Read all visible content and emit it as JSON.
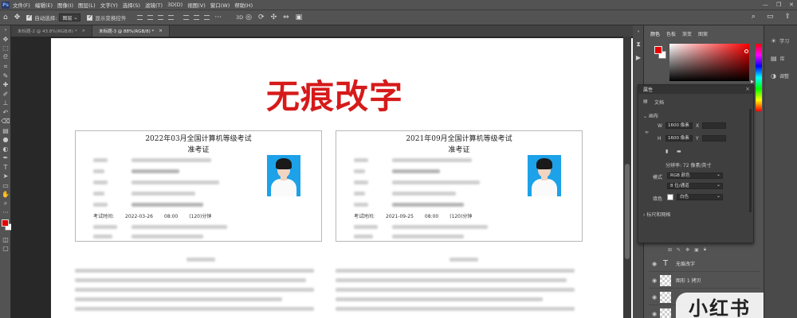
{
  "app": {
    "logo": "Ps"
  },
  "menu": [
    "文件(F)",
    "编辑(E)",
    "图像(I)",
    "图层(L)",
    "文字(Y)",
    "选择(S)",
    "滤镜(T)",
    "3D(D)",
    "视图(V)",
    "窗口(W)",
    "帮助(H)"
  ],
  "window_controls": [
    "—",
    "❐",
    "✕"
  ],
  "options": {
    "auto_select_label": "自动选择:",
    "auto_select_value": "图层",
    "show_transform_label": "显示变换控件"
  },
  "tabs": [
    {
      "label": "未标题-2 @ 43.8%(RGB/8) *",
      "close": "×"
    },
    {
      "label": "未标题-3 @ 88%(RGB/8) *",
      "close": "×"
    }
  ],
  "document": {
    "title": "无痕改字",
    "title_color": "#d61a1a",
    "cards": [
      {
        "title": "2022年03月全国计算机等级考试",
        "subtitle": "准考证",
        "exam_time_label": "考试时间:",
        "exam_date": "2022-03-26",
        "exam_clock": "08:00",
        "exam_duration": "(120)分钟"
      },
      {
        "title": "2021年09月全国计算机等级考试",
        "subtitle": "准考证",
        "exam_time_label": "考试时间:",
        "exam_date": "2021-09-25",
        "exam_clock": "08:00",
        "exam_duration": "(120)分钟"
      }
    ]
  },
  "color_panel": {
    "tabs": [
      "颜色",
      "色板",
      "渐变",
      "图案"
    ],
    "foreground": "#e60000",
    "background": "#ffffff"
  },
  "properties": {
    "header": "属性",
    "doc_label": "文档",
    "canvas_section": "画布",
    "w_label": "W",
    "w_value": "1600 像素",
    "x_label": "X",
    "h_label": "H",
    "h_value": "1600 像素",
    "y_label": "Y",
    "resolution": "分辨率: 72 像素/英寸",
    "mode_label": "模式",
    "mode_value": "RGB 颜色",
    "depth_value": "8 位/通道",
    "fill_label": "填色",
    "fill_value": "白色",
    "rulers_section": "标尺和网格"
  },
  "layers": [
    {
      "type": "text",
      "name": "无痕改字"
    },
    {
      "type": "raster",
      "name": "图形 1 拷贝"
    },
    {
      "type": "raster",
      "name": ""
    },
    {
      "type": "raster",
      "name": ""
    }
  ],
  "right_dock": [
    "学习",
    "库",
    "调整"
  ],
  "watermark": "小红书"
}
